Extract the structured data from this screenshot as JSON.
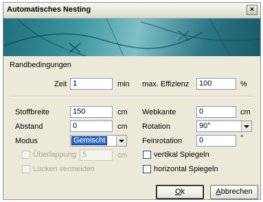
{
  "window": {
    "title": "Automatisches Nesting",
    "close_label": "×"
  },
  "group": {
    "title": "Randbedingungen"
  },
  "fields": {
    "zeit": {
      "label": "Zeit",
      "value": "1",
      "unit": "min"
    },
    "max_effizienz": {
      "label": "max. Effizienz",
      "value": "100",
      "unit": "%"
    },
    "stoffbreite": {
      "label": "Stoffbreite",
      "value": "150",
      "unit": "cm"
    },
    "webkante": {
      "label": "Webkante",
      "value": "0",
      "unit": "cm"
    },
    "abstand": {
      "label": "Abstand",
      "value": "0",
      "unit": "cm"
    },
    "rotation": {
      "label": "Rotation",
      "value": "90°"
    },
    "modus": {
      "label": "Modus",
      "value": "Gemischt"
    },
    "feinrotation": {
      "label": "Feinrotation",
      "value": "0",
      "unit": "°"
    },
    "ueberlappung": {
      "label": "Überlappung",
      "value": "5",
      "unit": "cm",
      "checked": false,
      "enabled": false
    },
    "vertikal_spiegeln": {
      "label": "vertikal Spiegeln",
      "checked": false
    },
    "luecken_vermeiden": {
      "label": "Lücken vermeiden",
      "checked": false,
      "enabled": false
    },
    "horizontal_spiegeln": {
      "label": "horizontal Spiegeln",
      "checked": false
    }
  },
  "buttons": {
    "ok_mnemonic": "O",
    "ok_rest": "k",
    "cancel_mnemonic": "A",
    "cancel_rest": "bbrechen"
  }
}
